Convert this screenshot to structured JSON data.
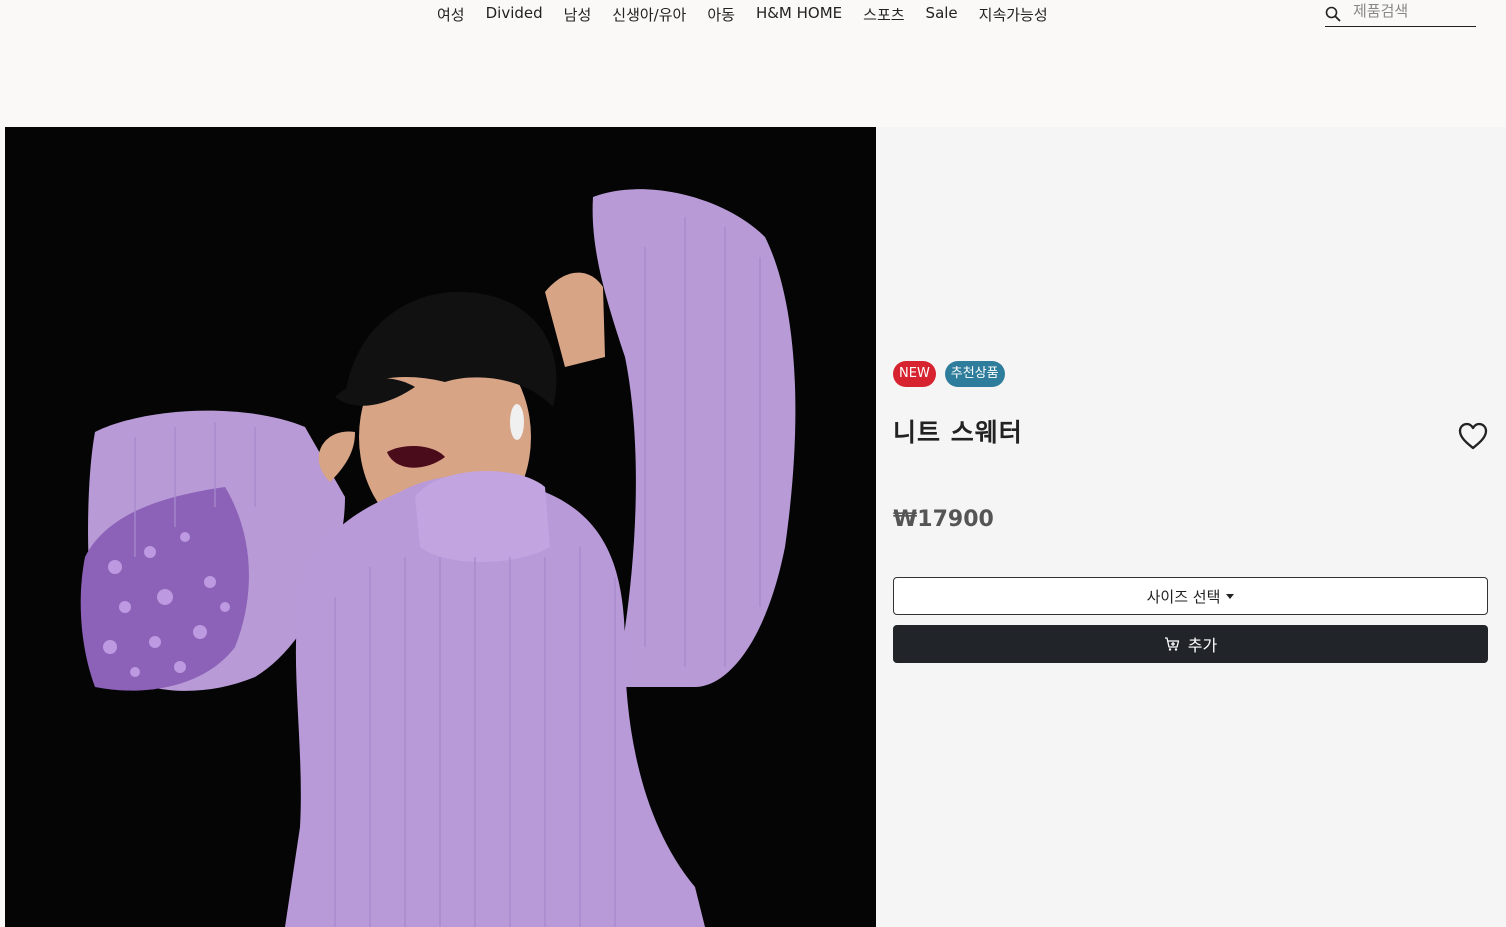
{
  "nav": {
    "items": [
      {
        "label": "여성"
      },
      {
        "label": "Divided"
      },
      {
        "label": "남성"
      },
      {
        "label": "신생아/유아"
      },
      {
        "label": "아동"
      },
      {
        "label": "H&M HOME"
      },
      {
        "label": "스포츠"
      },
      {
        "label": "Sale"
      },
      {
        "label": "지속가능성"
      }
    ]
  },
  "search": {
    "placeholder": "제품검색",
    "icon": "search-icon"
  },
  "product": {
    "badges": {
      "new": "NEW",
      "recommended": "추천상품"
    },
    "title": "니트 스웨터",
    "price": "₩17900",
    "size_label": "사이즈 선택",
    "add_label": "추가",
    "favorite_icon": "heart-icon",
    "cart_icon": "cart-plus-icon",
    "image_icon": "product-photo"
  },
  "colors": {
    "badge_new": "#d6232f",
    "badge_recommended": "#2f7d9c",
    "add_button": "#212529",
    "sweater": "#b99ad9"
  }
}
